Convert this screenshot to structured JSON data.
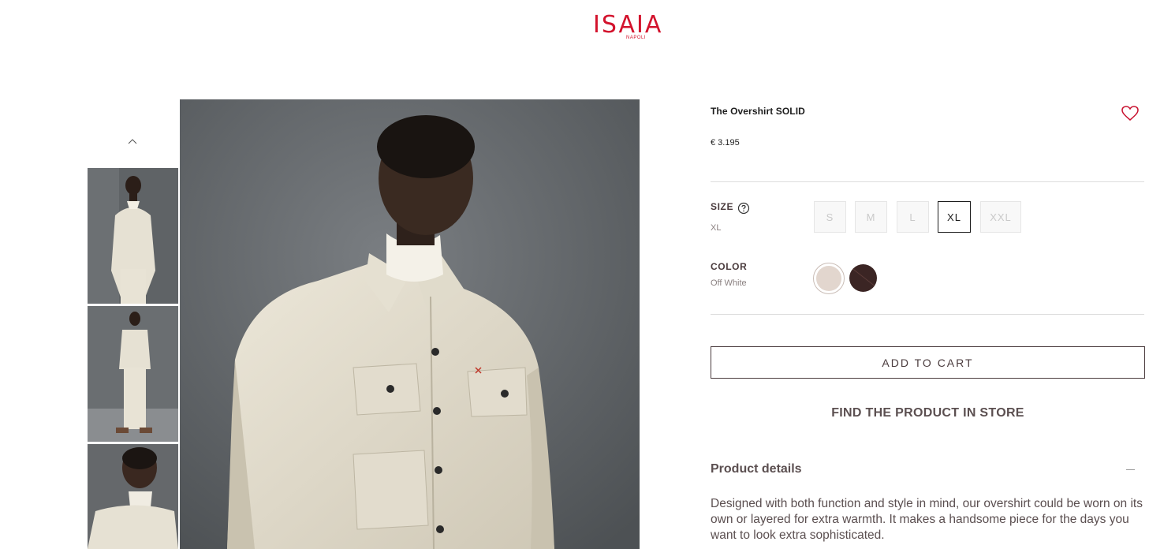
{
  "brand": {
    "name": "ISAIA",
    "sub": "NAPOLI",
    "color": "#d3132d"
  },
  "gallery": {
    "thumbnails": [
      "thumbnail-1",
      "thumbnail-2",
      "thumbnail-3"
    ],
    "up_icon": "chevron-up-icon"
  },
  "product": {
    "title": "The Overshirt SOLID",
    "price": "€ 3.195",
    "wishlist_icon": "heart-icon",
    "size": {
      "label": "SIZE",
      "selected": "XL",
      "help_icon": "question-circle-icon",
      "options": [
        "S",
        "M",
        "L",
        "XL",
        "XXL"
      ]
    },
    "color": {
      "label": "COLOR",
      "selected": "Off White",
      "swatches": [
        "#e2d6ce",
        "#3b2524"
      ]
    },
    "add_to_cart": "ADD TO CART",
    "find_in_store": "FIND THE PRODUCT IN STORE",
    "details": {
      "heading": "Product details",
      "toggle_icon": "minus-icon",
      "text": "Designed with both function and style in mind, our overshirt could be worn on its own or layered for extra warmth. It makes a handsome piece for the days you want to look extra sophisticated."
    }
  }
}
